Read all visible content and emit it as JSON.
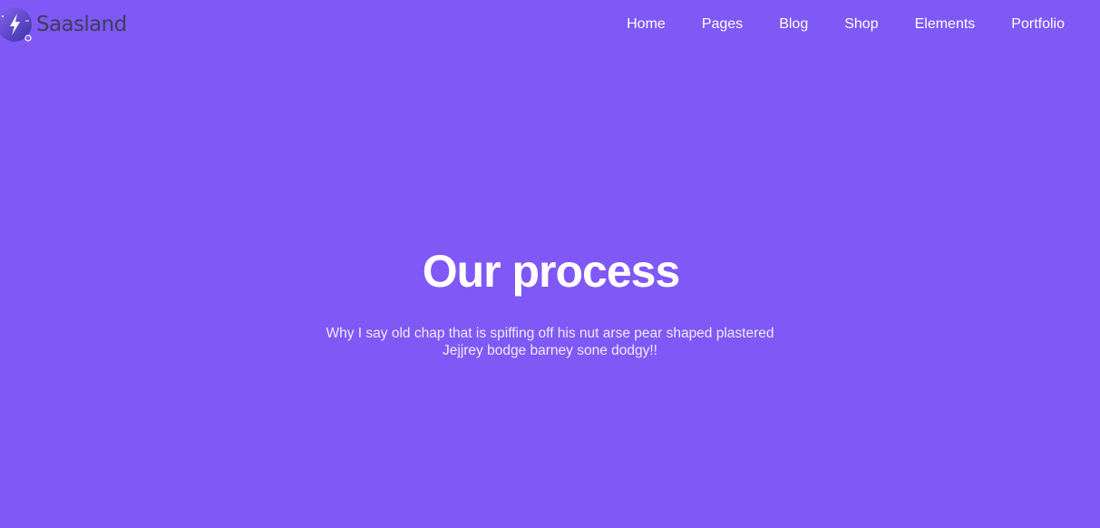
{
  "brand": {
    "name": "Saasland",
    "logo_icon": "lightning-bolt-icon",
    "logo_colors": [
      "#6c4fe8",
      "#3c3ab8",
      "#ffffff"
    ]
  },
  "nav": {
    "items": [
      {
        "label": "Home"
      },
      {
        "label": "Pages"
      },
      {
        "label": "Blog"
      },
      {
        "label": "Shop"
      },
      {
        "label": "Elements"
      },
      {
        "label": "Portfolio"
      }
    ]
  },
  "hero": {
    "title": "Our process",
    "subtitle_line1": "Why I say old chap that is spiffing off his nut arse pear shaped plastered",
    "subtitle_line2": "Jejjrey bodge barney sone dodgy!!"
  },
  "colors": {
    "background": "#7f58f6",
    "text": "#ffffff",
    "logo_text": "#3d3d5c"
  }
}
